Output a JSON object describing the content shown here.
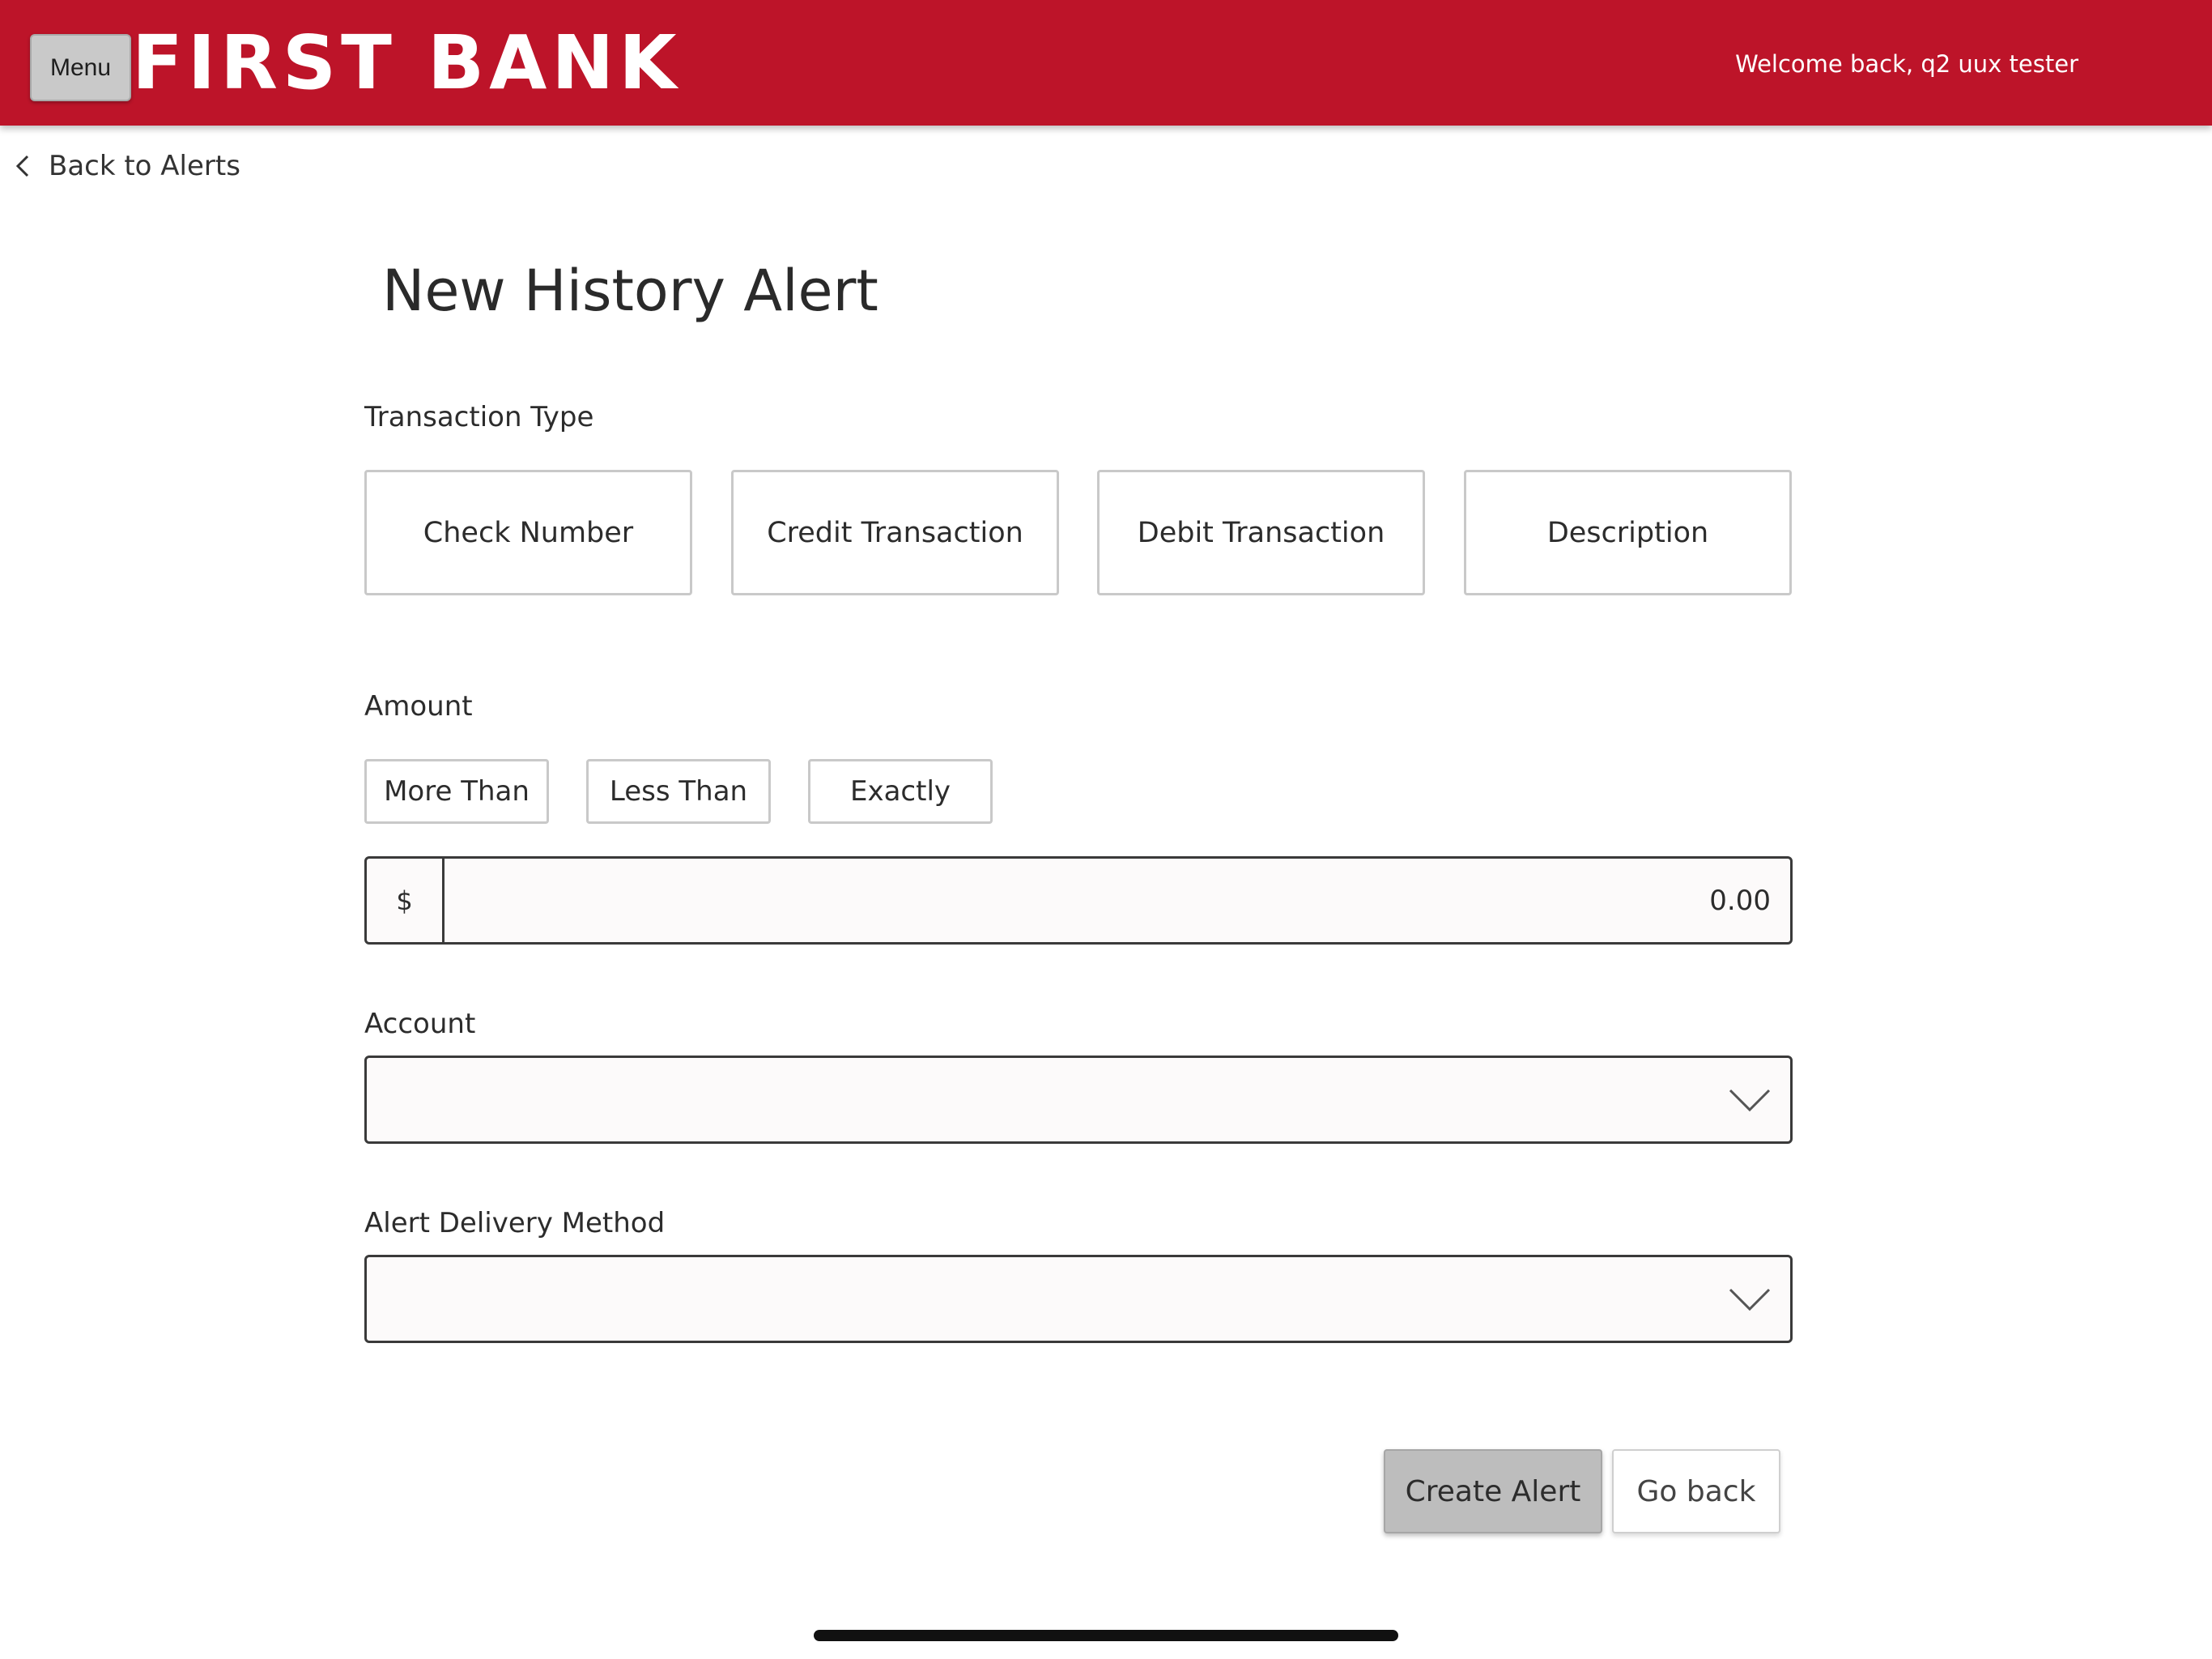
{
  "header": {
    "menu_label": "Menu",
    "logo_text": "FIRST BANK",
    "welcome_text": "Welcome back, q2 uux tester",
    "brand_color": "#bd1429"
  },
  "nav": {
    "back_label": "Back to Alerts"
  },
  "page": {
    "title": "New History Alert"
  },
  "transaction_type": {
    "label": "Transaction Type",
    "options": [
      "Check Number",
      "Credit Transaction",
      "Debit Transaction",
      "Description"
    ]
  },
  "amount": {
    "label": "Amount",
    "options": [
      "More Than",
      "Less Than",
      "Exactly"
    ],
    "currency_symbol": "$",
    "value": "0.00"
  },
  "account": {
    "label": "Account",
    "value": ""
  },
  "delivery": {
    "label": "Alert Delivery Method",
    "value": ""
  },
  "actions": {
    "create_label": "Create Alert",
    "go_back_label": "Go back"
  }
}
